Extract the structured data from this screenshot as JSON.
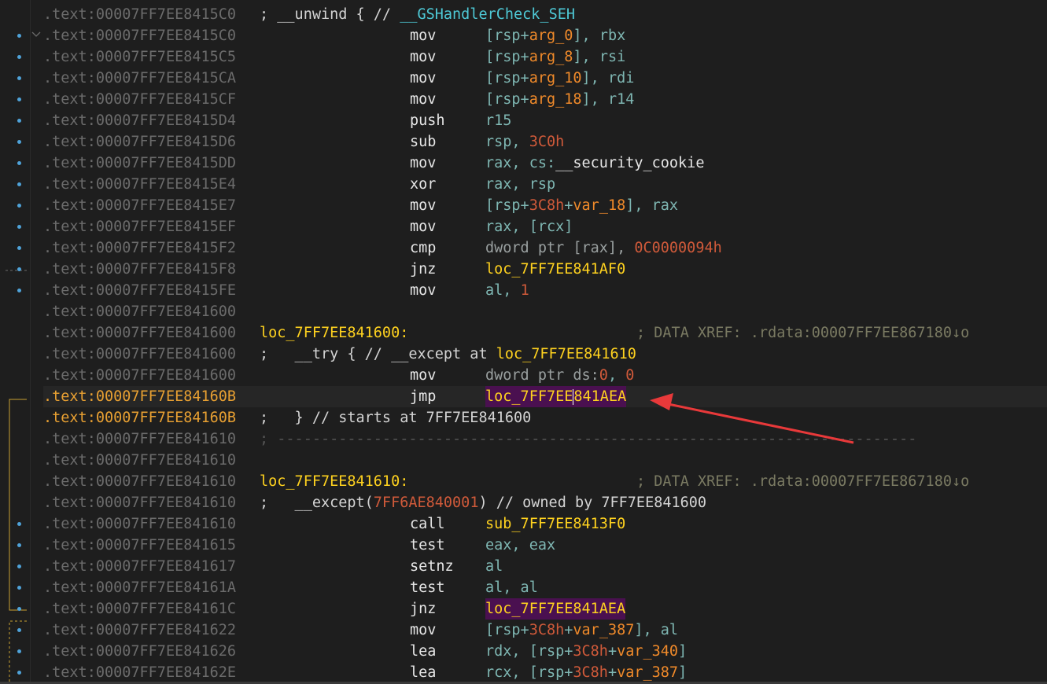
{
  "segment": ".text",
  "lines": [
    {
      "addr": "00007FF7EE8415C0",
      "kind": "comment",
      "text": "; __unwind { // ",
      "accent": "__GSHandlerCheck_SEH"
    },
    {
      "addr": "00007FF7EE8415C0",
      "mnem": "mov",
      "ops": [
        [
          "[rsp+",
          "reg"
        ],
        [
          "arg_0",
          "orange"
        ],
        [
          "], rbx",
          "reg"
        ]
      ]
    },
    {
      "addr": "00007FF7EE8415C5",
      "mnem": "mov",
      "ops": [
        [
          "[rsp+",
          "reg"
        ],
        [
          "arg_8",
          "orange"
        ],
        [
          "], rsi",
          "reg"
        ]
      ]
    },
    {
      "addr": "00007FF7EE8415CA",
      "mnem": "mov",
      "ops": [
        [
          "[rsp+",
          "reg"
        ],
        [
          "arg_10",
          "orange"
        ],
        [
          "], rdi",
          "reg"
        ]
      ]
    },
    {
      "addr": "00007FF7EE8415CF",
      "mnem": "mov",
      "ops": [
        [
          "[rsp+",
          "reg"
        ],
        [
          "arg_18",
          "orange"
        ],
        [
          "], r14",
          "reg"
        ]
      ]
    },
    {
      "addr": "00007FF7EE8415D4",
      "mnem": "push",
      "ops": [
        [
          "r15",
          "reg"
        ]
      ]
    },
    {
      "addr": "00007FF7EE8415D6",
      "mnem": "sub",
      "ops": [
        [
          "rsp, ",
          "reg"
        ],
        [
          "3C0h",
          "red"
        ]
      ]
    },
    {
      "addr": "00007FF7EE8415DD",
      "mnem": "mov",
      "ops": [
        [
          "rax, cs:",
          "reg"
        ],
        [
          "__security_cookie",
          "white"
        ]
      ]
    },
    {
      "addr": "00007FF7EE8415E4",
      "mnem": "xor",
      "ops": [
        [
          "rax, rsp",
          "reg"
        ]
      ]
    },
    {
      "addr": "00007FF7EE8415E7",
      "mnem": "mov",
      "ops": [
        [
          "[rsp+",
          "reg"
        ],
        [
          "3C8h",
          "red"
        ],
        [
          "+",
          "reg"
        ],
        [
          "var_18",
          "orange"
        ],
        [
          "], rax",
          "reg"
        ]
      ]
    },
    {
      "addr": "00007FF7EE8415EF",
      "mnem": "mov",
      "ops": [
        [
          "rax, [rcx]",
          "reg"
        ]
      ]
    },
    {
      "addr": "00007FF7EE8415F2",
      "mnem": "cmp",
      "ops": [
        [
          "dword ptr [rax], ",
          "ptr"
        ],
        [
          "0C0000094h",
          "red"
        ]
      ]
    },
    {
      "addr": "00007FF7EE8415F8",
      "mnem": "jnz",
      "ops": [
        [
          "loc_7FF7EE841AF0",
          "yellow"
        ]
      ]
    },
    {
      "addr": "00007FF7EE8415FE",
      "mnem": "mov",
      "ops": [
        [
          "al, ",
          "reg"
        ],
        [
          "1",
          "red"
        ]
      ]
    },
    {
      "addr": "00007FF7EE841600",
      "kind": "blank"
    },
    {
      "addr": "00007FF7EE841600",
      "kind": "label",
      "label": "loc_7FF7EE841600:",
      "xref": "; DATA XREF: .rdata:00007FF7EE867180↓o"
    },
    {
      "addr": "00007FF7EE841600",
      "kind": "comment",
      "text": ";   __try { // __except at ",
      "accent2": "loc_7FF7EE841610"
    },
    {
      "addr": "00007FF7EE841600",
      "mnem": "mov",
      "ops": [
        [
          "dword ptr ds:",
          "ptr"
        ],
        [
          "0",
          "red"
        ],
        [
          ", ",
          "reg"
        ],
        [
          "0",
          "red"
        ]
      ]
    },
    {
      "addr": "00007FF7EE84160B",
      "mnem": "jmp",
      "current": true,
      "hlAddr": true,
      "ops": [
        [
          "loc_7FF7EE841AEA",
          "yellow-hl"
        ]
      ]
    },
    {
      "addr": "00007FF7EE84160B",
      "kind": "comment",
      "hlAddr": true,
      "text": ";   } // starts at 7FF7EE841600"
    },
    {
      "addr": "00007FF7EE841610",
      "kind": "separator",
      "text": "; -------------------------------------------------------------------------"
    },
    {
      "addr": "00007FF7EE841610",
      "kind": "blank"
    },
    {
      "addr": "00007FF7EE841610",
      "kind": "label",
      "label": "loc_7FF7EE841610:",
      "xref": "; DATA XREF: .rdata:00007FF7EE867180↓o"
    },
    {
      "addr": "00007FF7EE841610",
      "kind": "except",
      "pre": ";   __except(",
      "val": "7FF6AE840001",
      "post": ") // owned by 7FF7EE841600"
    },
    {
      "addr": "00007FF7EE841610",
      "mnem": "call",
      "ops": [
        [
          "sub_7FF7EE8413F0",
          "yellow"
        ]
      ]
    },
    {
      "addr": "00007FF7EE841615",
      "mnem": "test",
      "ops": [
        [
          "eax, eax",
          "reg"
        ]
      ]
    },
    {
      "addr": "00007FF7EE841617",
      "mnem": "setnz",
      "ops": [
        [
          "al",
          "reg"
        ]
      ]
    },
    {
      "addr": "00007FF7EE84161A",
      "mnem": "test",
      "ops": [
        [
          "al, al",
          "reg"
        ]
      ]
    },
    {
      "addr": "00007FF7EE84161C",
      "mnem": "jnz",
      "ops": [
        [
          "loc_7FF7EE841AEA",
          "yellow-hl"
        ]
      ]
    },
    {
      "addr": "00007FF7EE841622",
      "mnem": "mov",
      "ops": [
        [
          "[rsp+",
          "reg"
        ],
        [
          "3C8h",
          "red"
        ],
        [
          "+",
          "reg"
        ],
        [
          "var_387",
          "orange"
        ],
        [
          "], al",
          "reg"
        ]
      ]
    },
    {
      "addr": "00007FF7EE841626",
      "mnem": "lea",
      "ops": [
        [
          "rdx, [rsp+",
          "reg"
        ],
        [
          "3C8h",
          "red"
        ],
        [
          "+",
          "reg"
        ],
        [
          "var_340",
          "orange"
        ],
        [
          "]",
          "reg"
        ]
      ]
    },
    {
      "addr": "00007FF7EE84162E",
      "mnem": "lea",
      "ops": [
        [
          "rcx, [rsp+",
          "reg"
        ],
        [
          "3C8h",
          "red"
        ],
        [
          "+",
          "reg"
        ],
        [
          "var_387",
          "orange"
        ],
        [
          "]",
          "reg"
        ]
      ]
    }
  ],
  "colors": {
    "background": "#1e1e1e",
    "address": "#6b6b6b",
    "address_highlight": "#e8a032",
    "label": "#ffd21f",
    "register": "#7fb7b3",
    "stackvar": "#f08a2a",
    "immediate": "#d05a3a",
    "mnemonic": "#e6e6e6",
    "arrow": "#e8393a",
    "label_highlight_bg": "#4a1050"
  },
  "icons": [
    "breakpoint-dot-icon",
    "collapse-chevron-icon",
    "annotation-arrow-icon"
  ]
}
